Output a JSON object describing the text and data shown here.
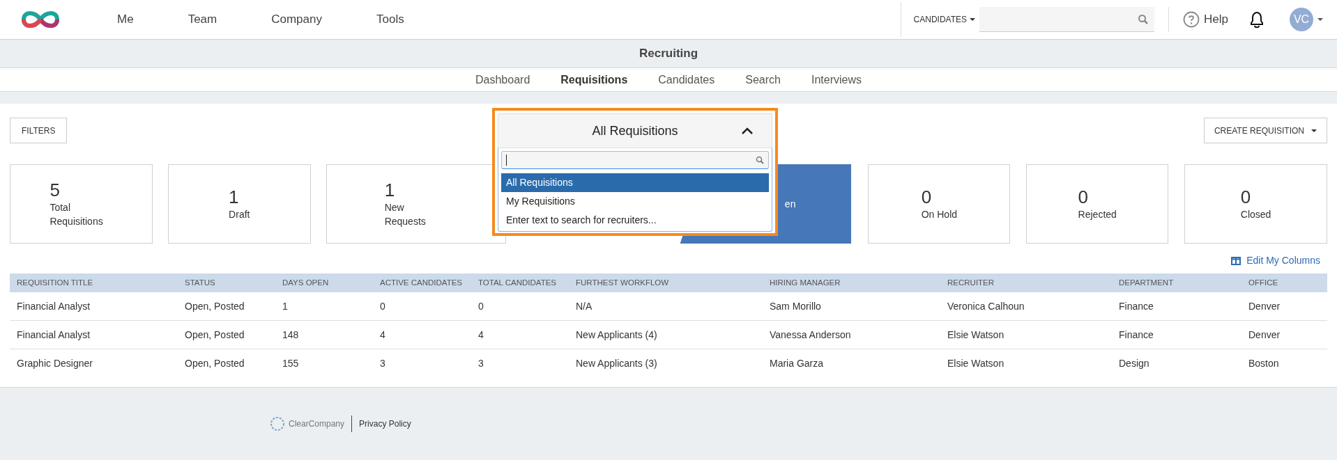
{
  "top_nav": {
    "items": [
      "Me",
      "Team",
      "Company",
      "Tools"
    ],
    "search_scope": "CANDIDATES",
    "help": "Help",
    "avatar": "VC"
  },
  "section_title": "Recruiting",
  "sub_tabs": [
    {
      "label": "Dashboard",
      "selected": false
    },
    {
      "label": "Requisitions",
      "selected": true
    },
    {
      "label": "Candidates",
      "selected": false
    },
    {
      "label": "Search",
      "selected": false
    },
    {
      "label": "Interviews",
      "selected": false
    }
  ],
  "filters_button": "FILTERS",
  "create_button": "CREATE REQUISITION",
  "requisition_filter": {
    "value": "All Requisitions",
    "expanded": true,
    "options": [
      {
        "label": "All Requisitions",
        "selected": true
      },
      {
        "label": "My Requisitions",
        "selected": false
      },
      {
        "label": "Enter text to search for recruiters...",
        "selected": false
      }
    ]
  },
  "stats": [
    {
      "count": "5",
      "label": "Total Requisitions",
      "selected": false
    },
    {
      "count": "1",
      "label": "Draft",
      "selected": false
    },
    {
      "count": "1",
      "label": "New Requests",
      "selected": false
    },
    {
      "label": "en",
      "selected": true
    },
    {
      "count": "0",
      "label": "On Hold",
      "selected": false
    },
    {
      "count": "0",
      "label": "Rejected",
      "selected": false
    },
    {
      "count": "0",
      "label": "Closed",
      "selected": false
    }
  ],
  "edit_columns_link": "Edit My Columns",
  "table": {
    "columns": [
      "REQUISITION TITLE",
      "STATUS",
      "DAYS OPEN",
      "ACTIVE CANDIDATES",
      "TOTAL CANDIDATES",
      "FURTHEST WORKFLOW",
      "HIRING MANAGER",
      "RECRUITER",
      "DEPARTMENT",
      "OFFICE"
    ],
    "rows": [
      [
        "Financial Analyst",
        "Open, Posted",
        "1",
        "0",
        "0",
        "N/A",
        "Sam Morillo",
        "Veronica Calhoun",
        "Finance",
        "Denver"
      ],
      [
        "Financial Analyst",
        "Open, Posted",
        "148",
        "4",
        "4",
        "New Applicants (4)",
        "Vanessa Anderson",
        "Elsie Watson",
        "Finance",
        "Denver"
      ],
      [
        "Graphic Designer",
        "Open, Posted",
        "155",
        "3",
        "3",
        "New Applicants (3)",
        "Maria Garza",
        "Elsie Watson",
        "Design",
        "Boston"
      ]
    ]
  },
  "footer": {
    "brand": "ClearCompany",
    "link": "Privacy Policy"
  }
}
